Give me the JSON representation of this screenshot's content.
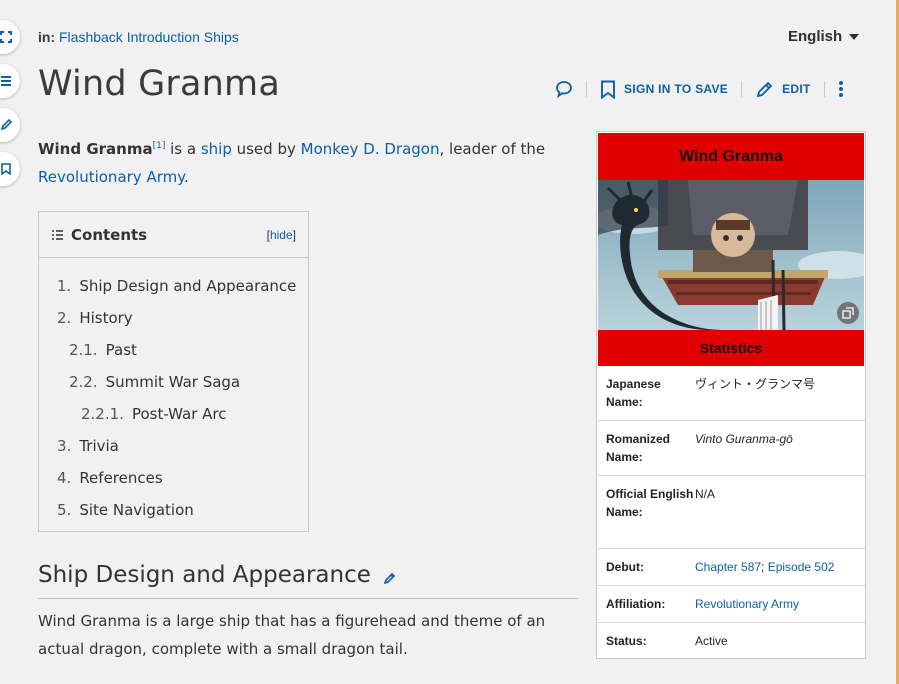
{
  "breadcrumb": {
    "prefix": "in:",
    "link": "Flashback Introduction Ships"
  },
  "language": "English",
  "title": "Wind Granma",
  "actions": {
    "sign_in": "SIGN IN TO SAVE",
    "edit": "EDIT"
  },
  "lead": {
    "bold": "Wind Granma",
    "ref": "[1]",
    "t1": " is a ",
    "ship_link": "ship",
    "t2": " used by ",
    "dragon_link": "Monkey D. Dragon",
    "t3": ", leader of the",
    "army_link": "Revolutionary Army",
    "t4": "."
  },
  "toc": {
    "title": "Contents",
    "hide_open": "[",
    "hide": "hide",
    "hide_close": "]",
    "items": [
      {
        "num": "1.",
        "label": "Ship Design and Appearance",
        "level": 1
      },
      {
        "num": "2.",
        "label": "History",
        "level": 1
      },
      {
        "num": "2.1.",
        "label": "Past",
        "level": 2
      },
      {
        "num": "2.2.",
        "label": "Summit War Saga",
        "level": 2
      },
      {
        "num": "2.2.1.",
        "label": "Post-War Arc",
        "level": 3
      },
      {
        "num": "3.",
        "label": "Trivia",
        "level": 1
      },
      {
        "num": "4.",
        "label": "References",
        "level": 1
      },
      {
        "num": "5.",
        "label": "Site Navigation",
        "level": 1
      }
    ]
  },
  "section": {
    "heading": "Ship Design and Appearance",
    "text": "Wind Granma is a large ship that has a figurehead and theme of an actual dragon, complete with a small dragon tail."
  },
  "infobox": {
    "title": "Wind Granma",
    "subheader": "Statistics",
    "rows": {
      "japanese_label": "Japanese Name:",
      "japanese_value": "ヴィント・グランマ号",
      "romanized_label": "Romanized Name:",
      "romanized_value": "Vinto Guranma-gō",
      "official_label": "Official English Name:",
      "official_value": "N/A",
      "debut_label": "Debut:",
      "debut_chapter": "Chapter 587",
      "debut_sep": "; ",
      "debut_episode": "Episode 502",
      "affiliation_label": "Affiliation:",
      "affiliation_value": "Revolutionary Army",
      "status_label": "Status:",
      "status_value": "Active"
    }
  },
  "colors": {
    "accent": "#0e5fa8",
    "infobox_header": "#e00000",
    "sidebar_edge": "#e9a95a"
  }
}
